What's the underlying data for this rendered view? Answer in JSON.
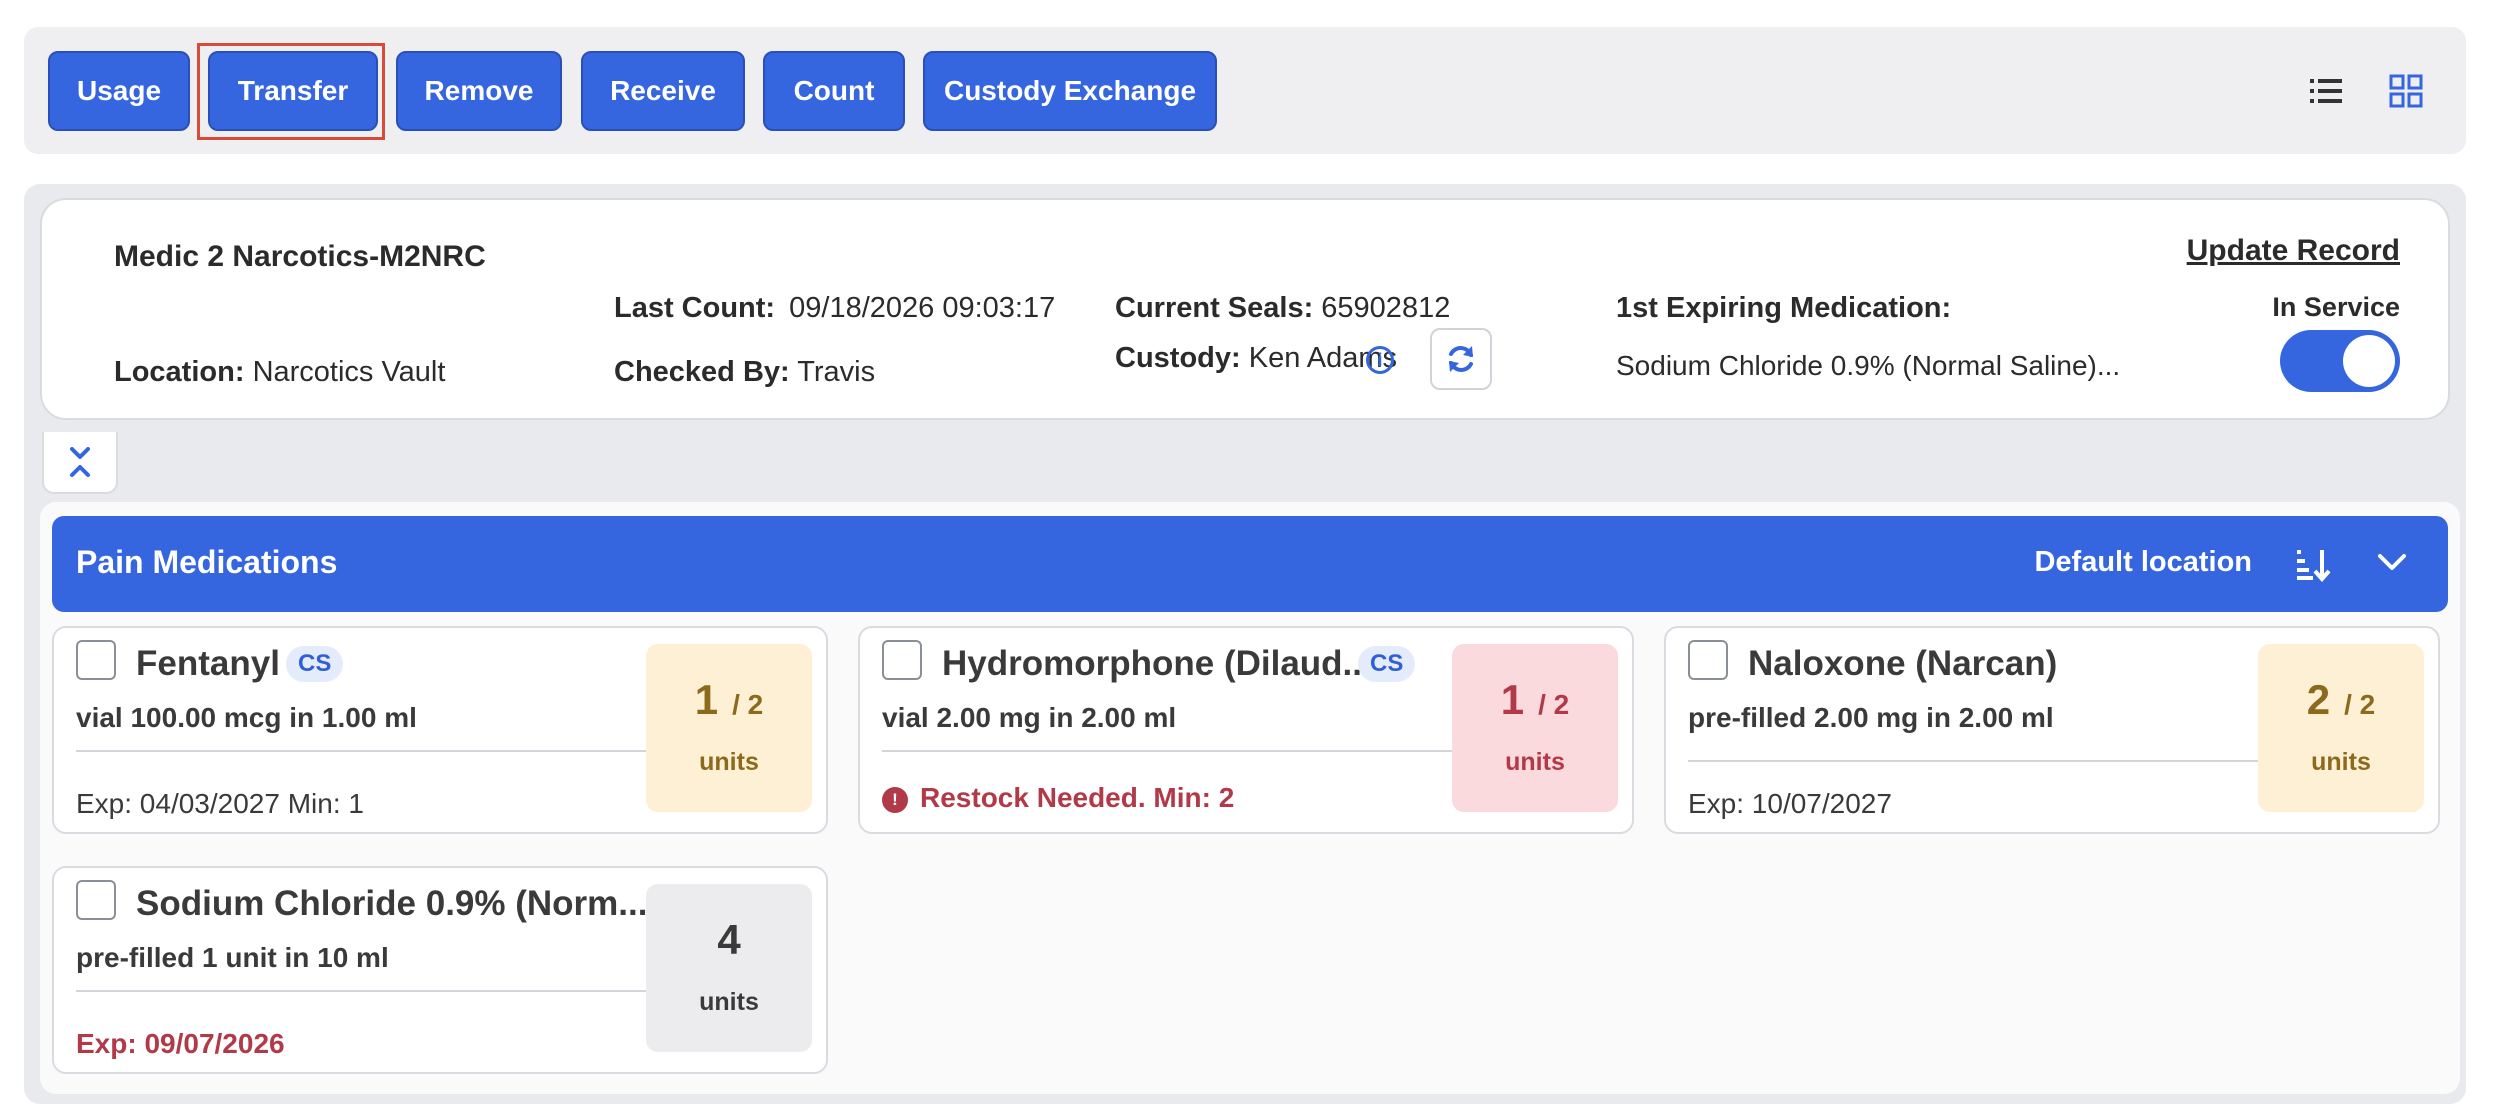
{
  "toolbar": {
    "buttons": [
      {
        "label": "Usage"
      },
      {
        "label": "Transfer"
      },
      {
        "label": "Remove"
      },
      {
        "label": "Receive"
      },
      {
        "label": "Count"
      },
      {
        "label": "Custody Exchange"
      }
    ],
    "view_icons": [
      "list-view-icon",
      "grid-view-icon"
    ]
  },
  "unit": {
    "name": "Medic 2 Narcotics-M2NRC",
    "update_link": "Update Record",
    "location_label": "Location:",
    "location_value": "Narcotics Vault",
    "last_count_label": "Last Count:",
    "last_count_value": "09/18/2026 09:03:17",
    "checked_by_label": "Checked By:",
    "checked_by_value": "Travis",
    "seals_label": "Current Seals:",
    "seals_value": "65902812",
    "custody_label": "Custody:",
    "custody_value": "Ken Adams",
    "expiring_label": "1st Expiring Medication:",
    "expiring_value": "Sodium Chloride 0.9% (Normal Saline)...",
    "service_label": "In Service",
    "in_service": true
  },
  "category": {
    "title": "Pain Medications",
    "location": "Default location"
  },
  "meds": [
    {
      "name": "Fentanyl",
      "cs": "CS",
      "desc": "vial 100.00 mcg in 1.00 ml",
      "footer": "Exp: 04/03/2027 Min: 1",
      "qty": "1",
      "par": "/ 2",
      "unit_label": "units"
    },
    {
      "name": "Hydromorphone (Dilaud...",
      "cs": "CS",
      "desc": "vial 2.00 mg in 2.00 ml",
      "footer": "Restock Needed.  Min: 2",
      "qty": "1",
      "par": "/ 2",
      "unit_label": "units"
    },
    {
      "name": "Naloxone (Narcan)",
      "desc": "pre-filled 2.00 mg in 2.00 ml",
      "footer": "Exp: 10/07/2027",
      "qty": "2",
      "par": "/ 2",
      "unit_label": "units"
    },
    {
      "name": "Sodium Chloride 0.9% (Norm...",
      "desc": "pre-filled 1 unit in 10 ml",
      "footer": "Exp: 09/07/2026",
      "qty": "4",
      "unit_label": "units"
    }
  ],
  "colors": {
    "accent": "#3566e0",
    "warning": "#b23a48",
    "amber": "#8c6a1c"
  }
}
